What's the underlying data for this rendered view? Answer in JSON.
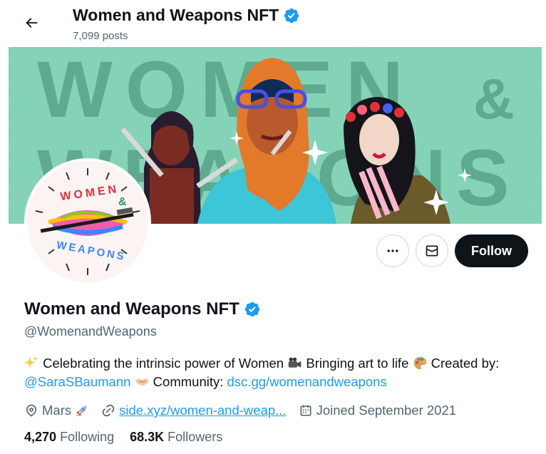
{
  "header": {
    "name": "Women and Weapons NFT",
    "posts_count": "7,099 posts"
  },
  "banner": {
    "big_text_line1": "WOMEN",
    "big_text_line2": "WEAPONS",
    "ampersand": "&"
  },
  "avatar": {
    "logo_top": "WOMEN",
    "logo_bottom": "WEAPONS",
    "logo_amp": "&"
  },
  "actions": {
    "follow_label": "Follow"
  },
  "profile": {
    "display_name": "Women and Weapons NFT",
    "handle": "@WomenandWeapons",
    "bio_part1": " Celebrating the intrinsic power of Women ",
    "bio_part2": " Bringing art to life ",
    "bio_part3": " Created by:",
    "bio_mention": "@SaraSBaumann",
    "bio_part4": " Community: ",
    "bio_link": "dsc.gg/womenandweapons",
    "location": "Mars",
    "website": "side.xyz/women-and-weap...",
    "joined": "Joined September 2021",
    "following_count": "4,270",
    "following_label": "Following",
    "followers_count": "68.3K",
    "followers_label": "Followers"
  },
  "colors": {
    "banner_bg": "#86d4b8",
    "verified_blue": "#1d9bf0",
    "follow_bg": "#0f1419",
    "secondary_text": "#536471"
  },
  "icons": {
    "back": "arrow-left-icon",
    "verified": "verified-badge-icon",
    "more": "more-icon",
    "message": "envelope-icon",
    "location": "location-pin-icon",
    "website": "link-icon",
    "calendar": "calendar-icon"
  }
}
